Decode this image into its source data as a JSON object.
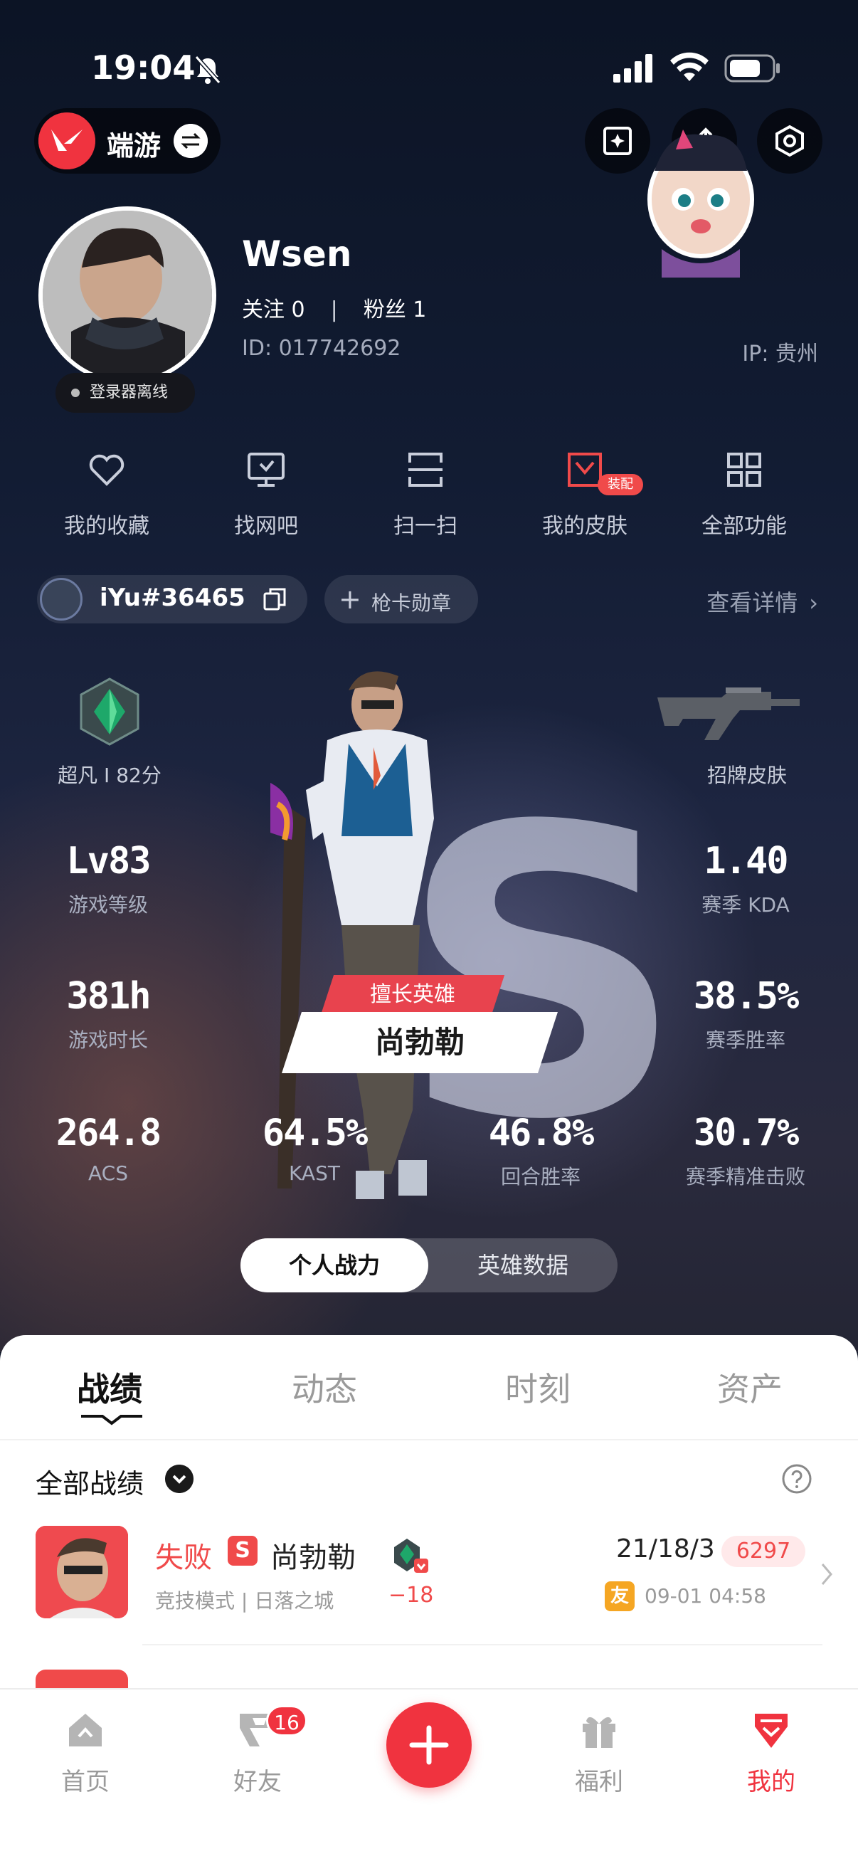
{
  "status_bar": {
    "time": "19:04"
  },
  "header": {
    "app_name": "端游",
    "accent_color": "#f0333f"
  },
  "profile": {
    "username": "Wsen",
    "following_label": "关注 0",
    "followers_label": "粉丝 1",
    "separator": "|",
    "id_text": "ID: 017742692",
    "ip_text": "IP: 贵州",
    "online_status": "登录器离线"
  },
  "quick_actions": [
    {
      "label": "我的收藏",
      "icon": "heart-icon"
    },
    {
      "label": "找网吧",
      "icon": "monitor-icon"
    },
    {
      "label": "扫一扫",
      "icon": "scan-icon"
    },
    {
      "label": "我的皮肤",
      "icon": "skin-icon",
      "badge": "装配"
    },
    {
      "label": "全部功能",
      "icon": "grid-icon"
    }
  ],
  "game_account": {
    "riot_id": "iYu#36465",
    "badge_button": "枪卡勋章",
    "detail_link": "查看详情"
  },
  "game_stats": {
    "rank_label": "超凡 I 82分",
    "signature_skin_label": "招牌皮肤",
    "favorite_agent_tag": "擅长英雄",
    "favorite_agent": "尚勃勒",
    "stats": [
      {
        "value": "Lv83",
        "label": "游戏等级"
      },
      {
        "value": "1.40",
        "label": "赛季 KDA"
      },
      {
        "value": "381h",
        "label": "游戏时长"
      },
      {
        "value": "38.5%",
        "label": "赛季胜率"
      },
      {
        "value": "264.8",
        "label": "ACS"
      },
      {
        "value": "64.5%",
        "label": "KAST"
      },
      {
        "value": "46.8%",
        "label": "回合胜率"
      },
      {
        "value": "30.7%",
        "label": "赛季精准击败"
      }
    ],
    "segment": {
      "active": "个人战力",
      "inactive": "英雄数据"
    }
  },
  "content_tabs": [
    "战绩",
    "动态",
    "时刻",
    "资产"
  ],
  "match_history": {
    "filter_label": "全部战绩",
    "matches": [
      {
        "result": "失败",
        "mode_badge": "S",
        "agent": "尚勃勒",
        "mode_map": "竞技模式 | 日落之城",
        "rank_delta": "−18",
        "kda": "21/18/3",
        "acs": "6297",
        "friend_badge": "友",
        "time": "09-01 04:58"
      }
    ]
  },
  "bottom_nav": [
    {
      "label": "首页",
      "icon": "home-icon"
    },
    {
      "label": "好友",
      "icon": "friends-icon",
      "badge": "16"
    },
    {
      "label": "",
      "icon": "plus-icon"
    },
    {
      "label": "福利",
      "icon": "gift-icon"
    },
    {
      "label": "我的",
      "icon": "profile-icon"
    }
  ]
}
